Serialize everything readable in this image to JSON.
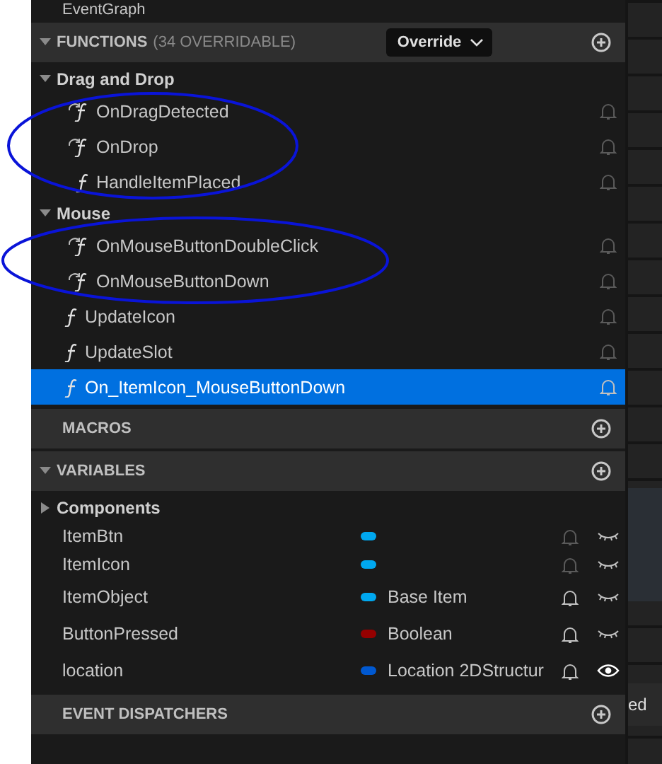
{
  "top_row": {
    "label": "EventGraph"
  },
  "functions": {
    "title": "FUNCTIONS",
    "count": "(34 OVERRIDABLE)",
    "expanded": true,
    "override_button": "Override",
    "categories": [
      {
        "name": "Drag and Drop",
        "expanded": true,
        "items": [
          {
            "name": "OnDragDetected",
            "kind": "override",
            "selected": false
          },
          {
            "name": "OnDrop",
            "kind": "override",
            "selected": false
          },
          {
            "name": "HandleItemPlaced",
            "kind": "function",
            "selected": false
          }
        ]
      },
      {
        "name": "Mouse",
        "expanded": true,
        "items": [
          {
            "name": "OnMouseButtonDoubleClick",
            "kind": "override",
            "selected": false
          },
          {
            "name": "OnMouseButtonDown",
            "kind": "override",
            "selected": false
          }
        ]
      }
    ],
    "items": [
      {
        "name": "UpdateIcon",
        "kind": "function",
        "selected": false
      },
      {
        "name": "UpdateSlot",
        "kind": "function",
        "selected": false
      },
      {
        "name": "On_ItemIcon_MouseButtonDown",
        "kind": "function",
        "selected": true
      }
    ]
  },
  "macros": {
    "title": "MACROS",
    "expanded": false
  },
  "variables": {
    "title": "VARIABLES",
    "expanded": true,
    "category": {
      "name": "Components",
      "expanded": false
    },
    "items": [
      {
        "name": "ItemBtn",
        "color": "#00a8f0",
        "replicated": false,
        "visible": false
      },
      {
        "name": "ItemIcon",
        "color": "#00a8f0",
        "replicated": false,
        "visible": false
      },
      {
        "name": "ItemObject",
        "type": "Base Item",
        "color": "#00a8f0",
        "replicated": true,
        "visible": false
      },
      {
        "name": "ButtonPressed",
        "type": "Boolean",
        "color": "#950000",
        "replicated": true,
        "visible": false
      },
      {
        "name": "location",
        "type": "Location 2DStructur",
        "color": "#0058d0",
        "replicated": true,
        "visible": true
      }
    ]
  },
  "event_dispatchers": {
    "title": "EVENT DISPATCHERS",
    "expanded": false
  },
  "graph": {
    "node_label": "ed"
  }
}
